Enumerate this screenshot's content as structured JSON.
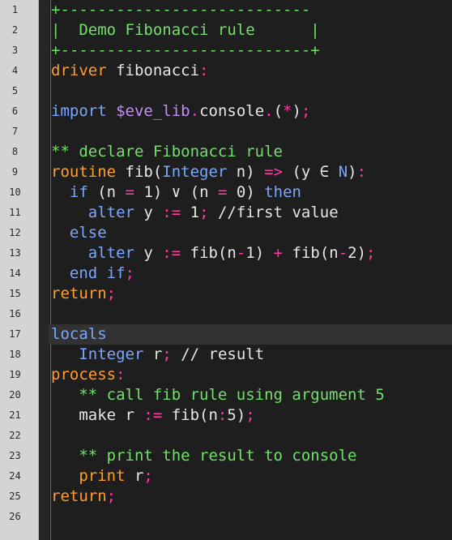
{
  "gutter": {
    "line_numbers": [
      "1",
      "2",
      "3",
      "4",
      "5",
      "6",
      "7",
      "8",
      "9",
      "10",
      "11",
      "12",
      "13",
      "14",
      "15",
      "16",
      "17",
      "18",
      "19",
      "20",
      "21",
      "22",
      "23",
      "24",
      "25",
      "26"
    ]
  },
  "colors": {
    "background": "#1e1e1e",
    "gutter": "#d4d4d4",
    "comment_green": "#72e06a",
    "keyword_orange": "#ff9e2c",
    "keyword_blue": "#7aa7ff",
    "operator_pink": "#ff3aa6",
    "plain": "#e6e6e6"
  },
  "active_line": 17,
  "lines": [
    [
      {
        "t": "+---------------------------",
        "c": "t-green"
      }
    ],
    [
      {
        "t": "|  Demo Fibonacci rule      |",
        "c": "t-green"
      }
    ],
    [
      {
        "t": "+---------------------------+",
        "c": "t-green"
      }
    ],
    [
      {
        "t": "driver",
        "c": "t-orange"
      },
      {
        "t": " fibonacci",
        "c": "t-plain"
      },
      {
        "t": ":",
        "c": "t-op"
      }
    ],
    [],
    [
      {
        "t": "import",
        "c": "t-blue"
      },
      {
        "t": " ",
        "c": "t-plain"
      },
      {
        "t": "$eve_lib",
        "c": "t-str"
      },
      {
        "t": ".",
        "c": "t-op"
      },
      {
        "t": "console",
        "c": "t-plain"
      },
      {
        "t": ".",
        "c": "t-op"
      },
      {
        "t": "(",
        "c": "t-plain"
      },
      {
        "t": "*",
        "c": "t-op"
      },
      {
        "t": ")",
        "c": "t-plain"
      },
      {
        "t": ";",
        "c": "t-op"
      }
    ],
    [],
    [
      {
        "t": "** declare Fibonacci rule",
        "c": "t-green"
      }
    ],
    [
      {
        "t": "routine",
        "c": "t-orange"
      },
      {
        "t": " fib(",
        "c": "t-plain"
      },
      {
        "t": "Integer",
        "c": "t-blue"
      },
      {
        "t": " n) ",
        "c": "t-plain"
      },
      {
        "t": "=>",
        "c": "t-op"
      },
      {
        "t": " (y ",
        "c": "t-plain"
      },
      {
        "t": "∈",
        "c": "t-plain"
      },
      {
        "t": " ",
        "c": "t-plain"
      },
      {
        "t": "N",
        "c": "t-blue"
      },
      {
        "t": ")",
        "c": "t-plain"
      },
      {
        "t": ":",
        "c": "t-op"
      }
    ],
    [
      {
        "t": "  ",
        "c": "t-plain"
      },
      {
        "t": "if",
        "c": "t-blue"
      },
      {
        "t": " (n ",
        "c": "t-plain"
      },
      {
        "t": "=",
        "c": "t-op"
      },
      {
        "t": " 1) ",
        "c": "t-plain"
      },
      {
        "t": "∨",
        "c": "t-plain"
      },
      {
        "t": " (n ",
        "c": "t-plain"
      },
      {
        "t": "=",
        "c": "t-op"
      },
      {
        "t": " 0) ",
        "c": "t-plain"
      },
      {
        "t": "then",
        "c": "t-blue"
      }
    ],
    [
      {
        "t": "    ",
        "c": "t-plain"
      },
      {
        "t": "alter",
        "c": "t-blue"
      },
      {
        "t": " y ",
        "c": "t-plain"
      },
      {
        "t": ":=",
        "c": "t-op"
      },
      {
        "t": " 1",
        "c": "t-plain"
      },
      {
        "t": ";",
        "c": "t-op"
      },
      {
        "t": " //first value",
        "c": "t-plain"
      }
    ],
    [
      {
        "t": "  ",
        "c": "t-plain"
      },
      {
        "t": "else",
        "c": "t-blue"
      }
    ],
    [
      {
        "t": "    ",
        "c": "t-plain"
      },
      {
        "t": "alter",
        "c": "t-blue"
      },
      {
        "t": " y ",
        "c": "t-plain"
      },
      {
        "t": ":=",
        "c": "t-op"
      },
      {
        "t": " fib(n",
        "c": "t-plain"
      },
      {
        "t": "-",
        "c": "t-op"
      },
      {
        "t": "1) ",
        "c": "t-plain"
      },
      {
        "t": "+",
        "c": "t-op"
      },
      {
        "t": " fib(n",
        "c": "t-plain"
      },
      {
        "t": "-",
        "c": "t-op"
      },
      {
        "t": "2)",
        "c": "t-plain"
      },
      {
        "t": ";",
        "c": "t-op"
      }
    ],
    [
      {
        "t": "  ",
        "c": "t-plain"
      },
      {
        "t": "end if",
        "c": "t-blue"
      },
      {
        "t": ";",
        "c": "t-op"
      }
    ],
    [
      {
        "t": "return",
        "c": "t-orange"
      },
      {
        "t": ";",
        "c": "t-op"
      }
    ],
    [],
    [
      {
        "t": "locals",
        "c": "t-blue"
      }
    ],
    [
      {
        "t": "   ",
        "c": "t-plain"
      },
      {
        "t": "Integer",
        "c": "t-blue"
      },
      {
        "t": " r",
        "c": "t-plain"
      },
      {
        "t": ";",
        "c": "t-op"
      },
      {
        "t": " // result",
        "c": "t-plain"
      }
    ],
    [
      {
        "t": "process",
        "c": "t-orange"
      },
      {
        "t": ":",
        "c": "t-op"
      }
    ],
    [
      {
        "t": "   ",
        "c": "t-plain"
      },
      {
        "t": "** call fib rule using argument 5",
        "c": "t-green"
      }
    ],
    [
      {
        "t": "   make r ",
        "c": "t-plain"
      },
      {
        "t": ":=",
        "c": "t-op"
      },
      {
        "t": " fib(n",
        "c": "t-plain"
      },
      {
        "t": ":",
        "c": "t-op"
      },
      {
        "t": "5)",
        "c": "t-plain"
      },
      {
        "t": ";",
        "c": "t-op"
      }
    ],
    [],
    [
      {
        "t": "   ",
        "c": "t-plain"
      },
      {
        "t": "** print the result to console",
        "c": "t-green"
      }
    ],
    [
      {
        "t": "   ",
        "c": "t-plain"
      },
      {
        "t": "print",
        "c": "t-orange"
      },
      {
        "t": " r",
        "c": "t-plain"
      },
      {
        "t": ";",
        "c": "t-op"
      }
    ],
    [
      {
        "t": "return",
        "c": "t-orange"
      },
      {
        "t": ";",
        "c": "t-op"
      }
    ],
    []
  ]
}
